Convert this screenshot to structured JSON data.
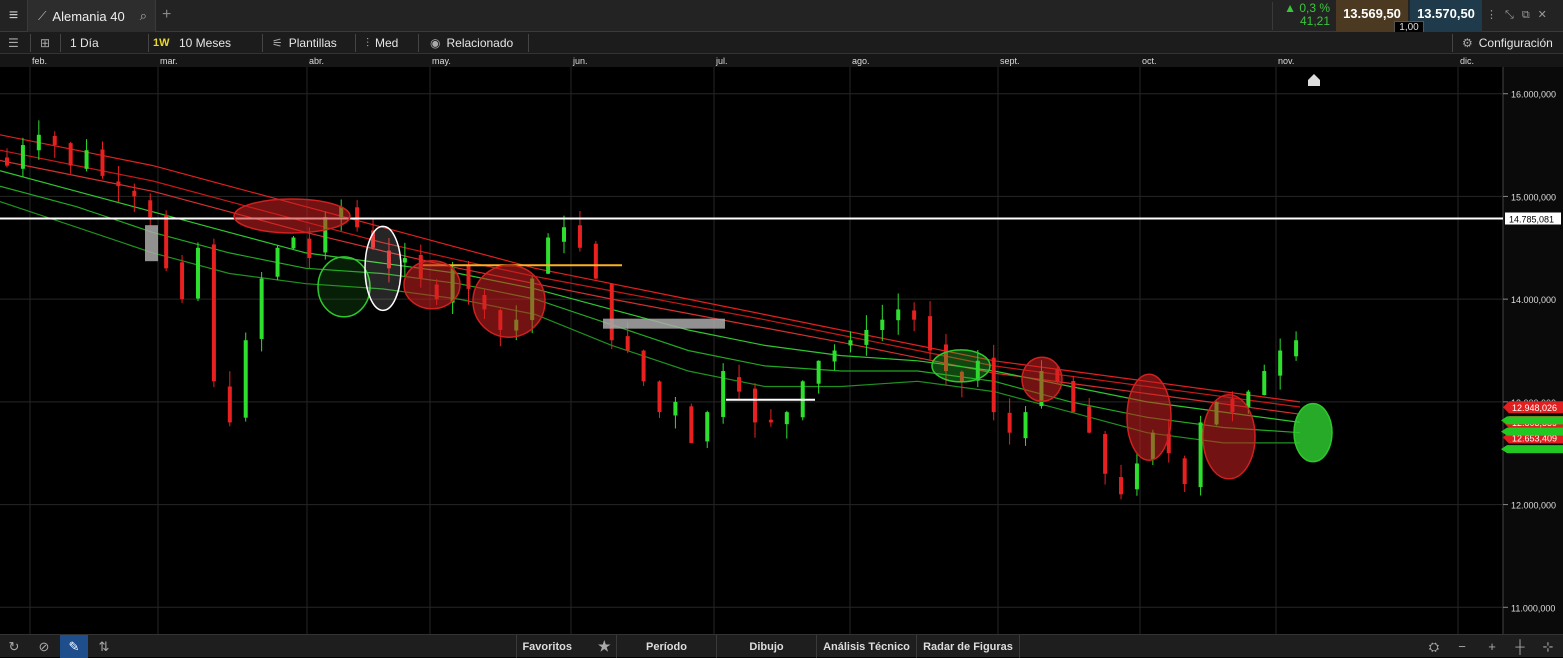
{
  "header": {
    "menu_icon": "hamburger-icon",
    "instrument": "Alemania 40",
    "change_pct": "0,3 %",
    "change_abs": "41,21",
    "bid": "13.569,50",
    "ask": "13.570,50",
    "spread": "1,00",
    "colors": {
      "bid_bg": "#4b3a21",
      "ask_bg": "#1f3a4a",
      "up": "#3cc43c"
    }
  },
  "toolbar": {
    "interval": "1 Día",
    "badge": "1W",
    "range": "10 Meses",
    "templates": "Plantillas",
    "price_type": "Med",
    "related": "Relacionado",
    "settings": "Configuración"
  },
  "bottom": {
    "favorites": "Favoritos",
    "period": "Período",
    "drawing": "Dibujo",
    "technical": "Análisis Técnico",
    "patterns": "Radar de Figuras"
  },
  "chart_data": {
    "type": "candlestick",
    "x_labels": [
      "feb.",
      "mar.",
      "abr.",
      "may.",
      "jun.",
      "jul.",
      "ago.",
      "sept.",
      "oct.",
      "nov.",
      "dic."
    ],
    "y_ticks": [
      "16.000,000",
      "15.000,000",
      "14.000,000",
      "13.000,000",
      "12.000,000",
      "11.000,000"
    ],
    "ylim": [
      10740,
      16260
    ],
    "horizontal_line": {
      "value": 14785.081,
      "label": "14.785,081"
    },
    "right_labels": [
      {
        "value": 12948.026,
        "label": "12.948,026"
      },
      {
        "value": 12803.559,
        "label": "12.803,559"
      },
      {
        "value": 12653.409,
        "label": "12.653,409"
      }
    ],
    "close_series_approx": [
      15300,
      15500,
      15600,
      15500,
      15300,
      15450,
      15200,
      15100,
      15000,
      14800,
      14300,
      14000,
      14500,
      13200,
      12800,
      13600,
      14200,
      14500,
      14600,
      14400,
      14800,
      14900,
      14700,
      14500,
      14300,
      14400,
      14200,
      14000,
      14300,
      14100,
      13900,
      13700,
      13800,
      14200,
      14600,
      14700,
      14500,
      14200,
      13600,
      13500,
      13200,
      12900,
      13000,
      12600,
      12900,
      13300,
      13100,
      12800,
      12800,
      12900,
      13200,
      13400,
      13500,
      13600,
      13700,
      13800,
      13900,
      13800,
      13500,
      13300,
      13200,
      13400,
      12900,
      12700,
      12900,
      13300,
      13200,
      12900,
      12700,
      12300,
      12100,
      12400,
      12700,
      12500,
      12200,
      12800,
      13000,
      12900,
      13100,
      13300,
      13500,
      13600
    ],
    "moving_averages": [
      {
        "color": "#e02020",
        "values": [
          15600,
          15450,
          15300,
          15100,
          14900,
          14700,
          14500,
          14300,
          14150,
          14000,
          13850,
          13700,
          13550,
          13400,
          13300,
          13200,
          13100,
          13000
        ]
      },
      {
        "color": "#c81818",
        "values": [
          15450,
          15300,
          15150,
          14950,
          14750,
          14550,
          14380,
          14220,
          14080,
          13940,
          13800,
          13650,
          13500,
          13350,
          13250,
          13150,
          13050,
          12950
        ]
      },
      {
        "color": "#d43030",
        "values": [
          15350,
          15200,
          15050,
          14850,
          14650,
          14470,
          14300,
          14150,
          14000,
          13860,
          13720,
          13580,
          13430,
          13280,
          13180,
          13080,
          12980,
          12880
        ]
      },
      {
        "color": "#2ec82e",
        "values": [
          15250,
          15050,
          14850,
          14650,
          14450,
          14350,
          14250,
          14100,
          13900,
          13700,
          13550,
          13450,
          13400,
          13300,
          13150,
          13000,
          12900,
          12800
        ]
      },
      {
        "color": "#22a822",
        "values": [
          15100,
          14900,
          14650,
          14450,
          14300,
          14250,
          14150,
          14000,
          13750,
          13500,
          13350,
          13300,
          13300,
          13200,
          13000,
          12850,
          12750,
          12700
        ]
      },
      {
        "color": "#1f901f",
        "values": [
          14950,
          14700,
          14450,
          14250,
          14150,
          14100,
          14000,
          13850,
          13550,
          13300,
          13150,
          13150,
          13200,
          13100,
          12900,
          12700,
          12600,
          12600
        ]
      }
    ]
  }
}
